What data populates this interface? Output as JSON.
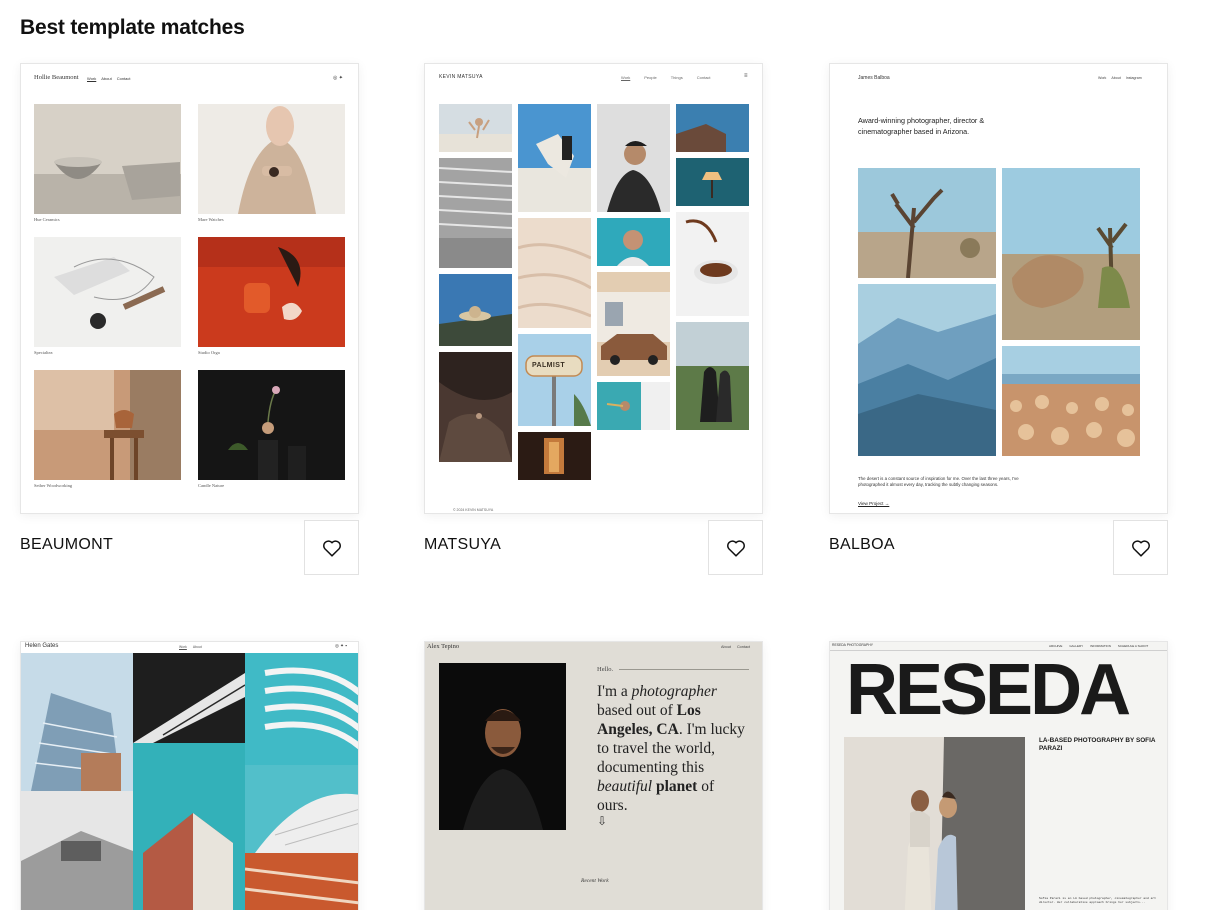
{
  "page": {
    "title": "Best template matches"
  },
  "templates": [
    {
      "name": "BEAUMONT",
      "site_name": "Hollie Beaumont",
      "nav": [
        "Work",
        "About",
        "Contact"
      ],
      "captions": [
        "Hue Ceramics",
        "Mare Watches",
        "Specialtea",
        "Studio Orga",
        "Sether Woodworking",
        "Candle Nature"
      ]
    },
    {
      "name": "MATSUYA",
      "site_name": "KEVIN MATSUYA",
      "nav": [
        "Work",
        "People",
        "Things",
        "Contact"
      ],
      "sign_text": "PALMIST",
      "footer": "© 2024 KEVIN MATSUYA"
    },
    {
      "name": "BALBOA",
      "site_name": "James Balboa",
      "nav": [
        "Work",
        "About",
        "Instagram"
      ],
      "headline": "Award-winning photographer, director & cinematographer based in Arizona.",
      "body": "The desert is a constant source of inspiration for me. Over the last three years, I've photographed it almost every day, tracking the subtly changing seasons.",
      "link": "View Project →"
    },
    {
      "name": "",
      "site_name": "Helen Gates",
      "nav": [
        "Work",
        "About"
      ]
    },
    {
      "name": "",
      "site_name": "Alex Tepino",
      "nav": [
        "About",
        "Contact"
      ],
      "hello": "Hello.",
      "intro_1": "I'm a ",
      "intro_em1": "photographer",
      "intro_2": " based out of ",
      "intro_b1": "Los Angeles, CA",
      "intro_3": ". I'm lucky to travel the world, documenting this ",
      "intro_em2": "beautiful",
      "intro_4": " ",
      "intro_b2": "planet",
      "intro_5": " of ours.",
      "signature": "Recent Work"
    },
    {
      "name": "",
      "site_name": "RESEDA PHOTOGRAPHY",
      "nav": [
        "ARCHIVE",
        "GALLERY",
        "INFORMATION",
        "SCHEDULE A SHOOT"
      ],
      "big_title": "RESEDA",
      "subtitle": "LA-BASED PHOTOGRAPHY BY SOFIA PARAZI",
      "blurb": "Sofia Parazi is an LA based photographer, cinematographer and art director. Her collaborative approach brings her subjects..."
    }
  ],
  "icons": {
    "favorite": "heart-outline-icon",
    "arrow": "down-arrow-icon"
  },
  "colors": {
    "text": "#111111",
    "border": "#e2e2e2",
    "reseda_black": "#1a1a1a",
    "tepino_bg": "#e0ddd6"
  }
}
